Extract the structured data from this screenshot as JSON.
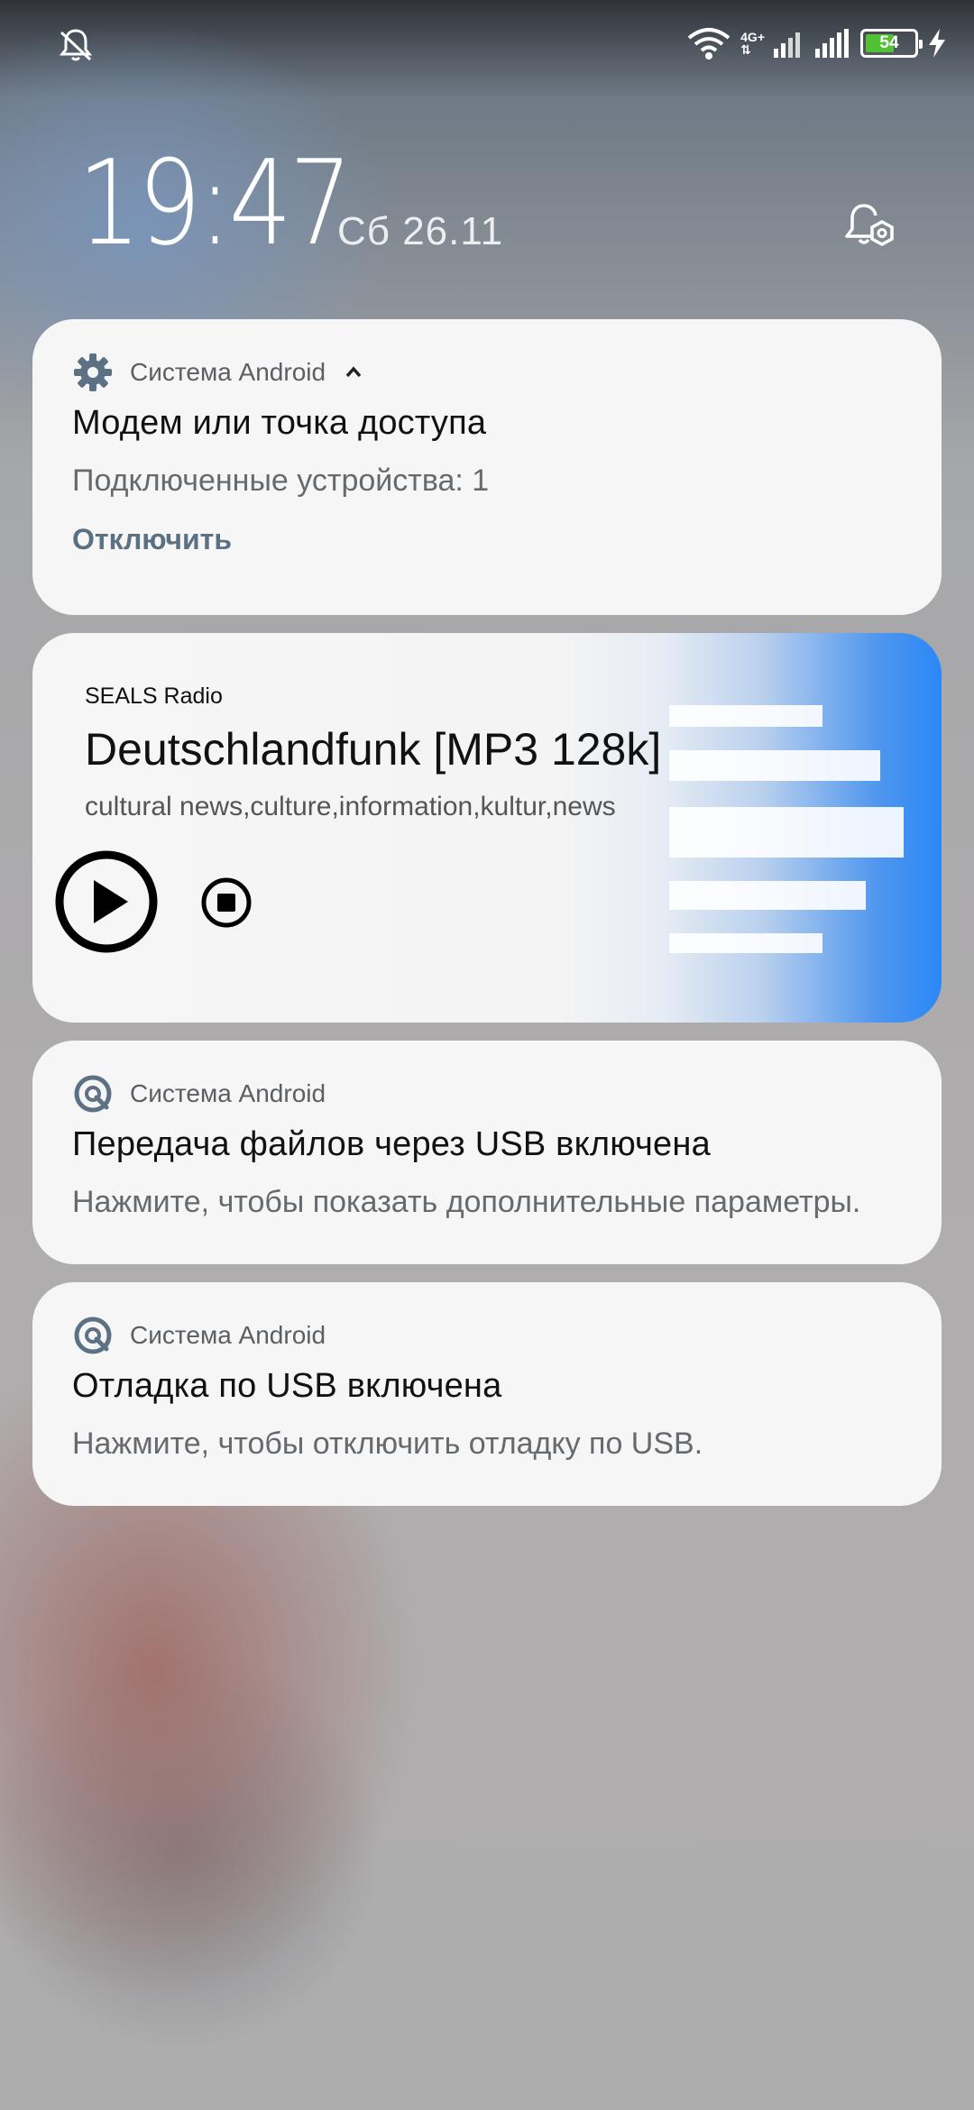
{
  "status_bar": {
    "network_type": "4G+",
    "battery_level": "54",
    "icons": [
      "notifications-off-icon",
      "wifi-icon",
      "signal-icon",
      "signal-icon",
      "battery-icon",
      "charging-icon"
    ]
  },
  "lockscreen": {
    "time": "19:47",
    "date": "Сб 26.11"
  },
  "notifications": [
    {
      "app": "Система Android",
      "title": "Модем или точка доступа",
      "text": "Подключенные устройства: 1",
      "action": "Отключить",
      "icon": "gear-icon"
    },
    {
      "app": "Система Android",
      "title": "Передача файлов через USB включена",
      "text": "Нажмите, чтобы показать дополнительные параметры.",
      "icon": "android-q-icon"
    },
    {
      "app": "Система Android",
      "title": "Отладка по USB включена",
      "text": "Нажмите, чтобы отключить отладку по USB.",
      "icon": "android-q-icon"
    }
  ],
  "media": {
    "source": "SEALS Radio",
    "title": "Deutschlandfunk [MP3 128k]",
    "subtitle": "cultural news,culture,information,kultur,news",
    "accent_color": "#2b88f7",
    "controls": [
      "play-icon",
      "stop-icon"
    ]
  }
}
